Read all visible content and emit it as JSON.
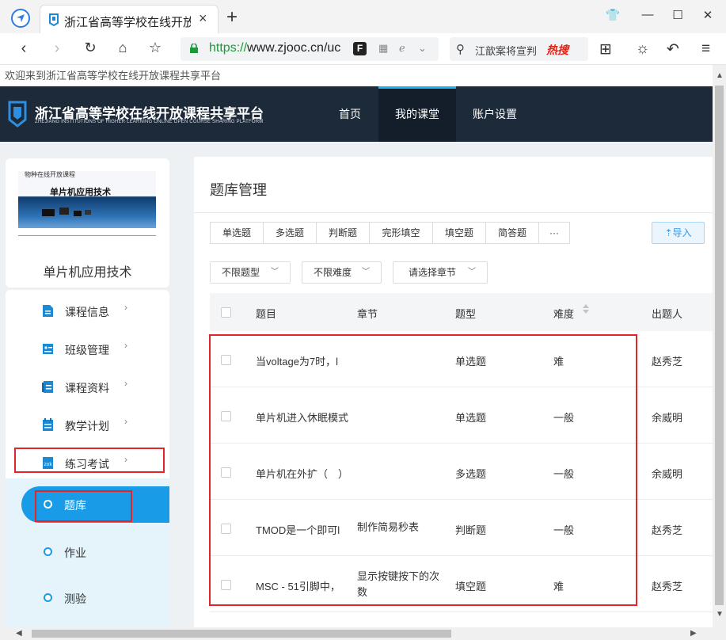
{
  "browser": {
    "tab_title": "浙江省高等学校在线开放",
    "tab_close": "×",
    "new_tab": "+",
    "url_scheme": "https://",
    "url_host": "www.zjooc.cn/uc",
    "search_text": "江歆案将宣判",
    "hot_label": "热搜"
  },
  "site": {
    "welcome": "欢迎来到浙江省高等学校在线开放课程共享平台",
    "name": "浙江省高等学校在线开放课程共享平台",
    "subtitle": "ZHEJIANG INSTITUTIONS OF HIGHER LEARNING ONLINE OPEN COURSE SHARING PLATFORM",
    "nav": [
      {
        "label": "首页"
      },
      {
        "label": "我的课堂"
      },
      {
        "label": "账户设置"
      }
    ],
    "active_nav_color": "#1bb0f0"
  },
  "course": {
    "banner_top": "物种在线开放课程",
    "banner_title": "单片机应用技术",
    "name": "单片机应用技术"
  },
  "sidebar": {
    "items": [
      {
        "label": "课程信息",
        "icon": "document-icon"
      },
      {
        "label": "班级管理",
        "icon": "class-icon"
      },
      {
        "label": "课程资料",
        "icon": "materials-icon"
      },
      {
        "label": "教学计划",
        "icon": "plan-icon"
      },
      {
        "label": "练习考试",
        "icon": "exam-icon"
      }
    ],
    "sub_items": [
      {
        "label": "题库"
      },
      {
        "label": "作业"
      },
      {
        "label": "测验"
      }
    ],
    "accent": "#1a9be8"
  },
  "content": {
    "title": "题库管理",
    "type_tabs": [
      "单选题",
      "多选题",
      "判断题",
      "完形填空",
      "填空题",
      "简答题",
      "···"
    ],
    "import_label": "⇡导入",
    "filters": [
      "不限题型",
      "不限难度",
      "请选择章节"
    ],
    "columns": [
      "题目",
      "章节",
      "题型",
      "难度",
      "出题人"
    ],
    "rows": [
      {
        "question": "当voltage为7时，l",
        "chapter": "",
        "type": "单选题",
        "difficulty": "难",
        "author": "赵秀芝"
      },
      {
        "question": "单片机进入休眠模式",
        "chapter": "",
        "type": "单选题",
        "difficulty": "一般",
        "author": "余威明"
      },
      {
        "question": "单片机在外扩（　）",
        "chapter": "",
        "type": "多选题",
        "difficulty": "一般",
        "author": "余威明"
      },
      {
        "question": "TMOD是一个即可l",
        "chapter": "制作简易秒表",
        "type": "判断题",
        "difficulty": "一般",
        "author": "赵秀芝"
      },
      {
        "question": "MSC - 51引脚中，",
        "chapter": "显示按键按下的次数",
        "type": "填空题",
        "difficulty": "难",
        "author": "赵秀芝"
      }
    ]
  }
}
